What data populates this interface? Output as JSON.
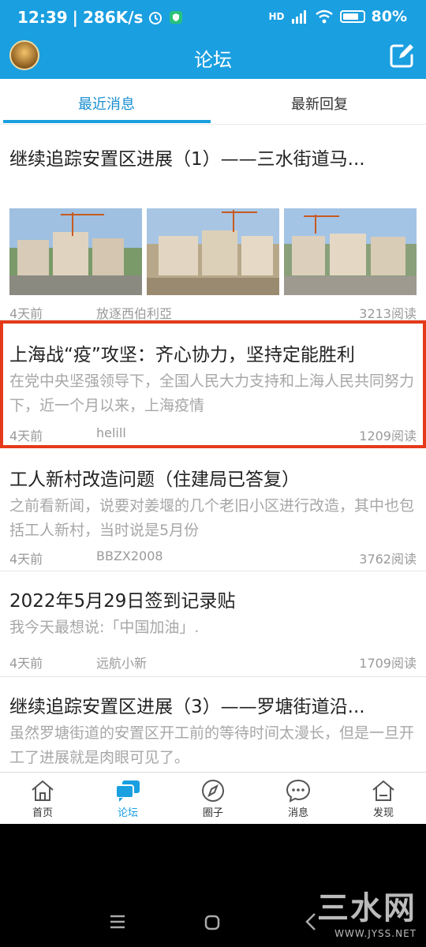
{
  "status": {
    "time": "12:39",
    "speed": "286K/s",
    "network": "HD",
    "battery": "80%"
  },
  "header": {
    "title": "论坛"
  },
  "tabs": [
    {
      "label": "最近消息",
      "active": true
    },
    {
      "label": "最新回复",
      "active": false
    }
  ],
  "posts": [
    {
      "title": "继续追踪安置区进展（1）——三水街道马...",
      "excerpt": "",
      "time": "4天前",
      "author": "放逐西伯利亞",
      "reads": "3213阅读"
    },
    {
      "title": "上海战“疫”攻坚：齐心协力，坚持定能胜利",
      "excerpt": "在党中央坚强领导下，全国人民大力支持和上海人民共同努力下，近一个月以来，上海疫情",
      "time": "4天前",
      "author": "helill",
      "reads": "1209阅读"
    },
    {
      "title": "工人新村改造问题（住建局已答复）",
      "excerpt": "之前看新闻，说要对姜堰的几个老旧小区进行改造，其中也包括工人新村，当时说是5月份",
      "time": "4天前",
      "author": "BBZX2008",
      "reads": "3762阅读"
    },
    {
      "title": "2022年5月29日签到记录贴",
      "excerpt": "我今天最想说:「中国加油」.",
      "time": "4天前",
      "author": "远航小新",
      "reads": "1709阅读"
    },
    {
      "title": "继续追踪安置区进展（3）——罗塘街道沿...",
      "excerpt": "虽然罗塘街道的安置区开工前的等待时间太漫长，但是一旦开工了进展就是肉眼可见了。",
      "time": "",
      "author": "",
      "reads": ""
    }
  ],
  "bottom_nav": [
    {
      "label": "首页",
      "icon": "home-icon",
      "active": false
    },
    {
      "label": "论坛",
      "icon": "forum-icon",
      "active": true
    },
    {
      "label": "圈子",
      "icon": "compass-icon",
      "active": false
    },
    {
      "label": "消息",
      "icon": "message-icon",
      "active": false
    },
    {
      "label": "发现",
      "icon": "discover-icon",
      "active": false
    }
  ],
  "watermark": {
    "big": "三水网",
    "small": "WWW.JYSS.NET"
  },
  "colors": {
    "brand": "#1a9fe0",
    "highlight": "#e53a1a"
  }
}
